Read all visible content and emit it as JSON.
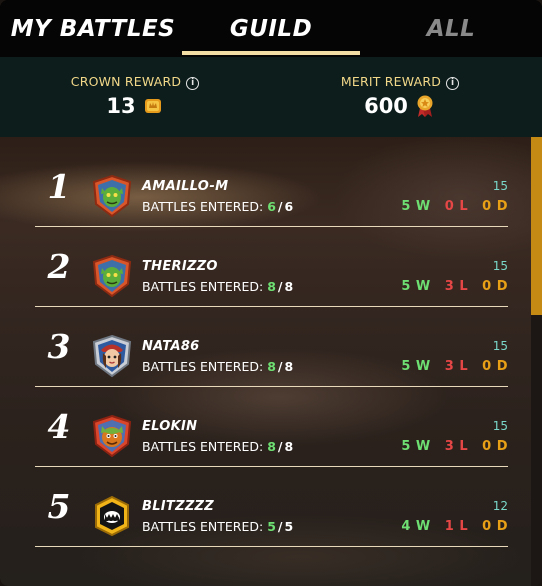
{
  "tabs": {
    "my_battles": "MY BATTLES",
    "guild": "GUILD",
    "all": "ALL",
    "active": "guild"
  },
  "rewards": {
    "crown": {
      "label": "CROWN REWARD",
      "value": "13",
      "icon": "crown-token-icon"
    },
    "merit": {
      "label": "MERIT REWARD",
      "value": "600",
      "icon": "merit-medal-icon"
    }
  },
  "battles_label": "BATTLES ENTERED:",
  "players": [
    {
      "rank": "1",
      "name": "AMAILLO-M",
      "entered": "6",
      "total": "6",
      "score": "15",
      "wins": "5 W",
      "losses": "0 L",
      "draws": "0 D",
      "avatar": "green-goblin-shield-avatar"
    },
    {
      "rank": "2",
      "name": "THERIZZO",
      "entered": "8",
      "total": "8",
      "score": "15",
      "wins": "5 W",
      "losses": "3 L",
      "draws": "0 D",
      "avatar": "green-goblin-shield-avatar"
    },
    {
      "rank": "3",
      "name": "NATA86",
      "entered": "8",
      "total": "8",
      "score": "15",
      "wins": "5 W",
      "losses": "3 L",
      "draws": "0 D",
      "avatar": "pirate-girl-shield-avatar"
    },
    {
      "rank": "4",
      "name": "ELOKIN",
      "entered": "8",
      "total": "8",
      "score": "15",
      "wins": "5 W",
      "losses": "3 L",
      "draws": "0 D",
      "avatar": "orange-goblin-shield-avatar"
    },
    {
      "rank": "5",
      "name": "BLITZZZZ",
      "entered": "5",
      "total": "5",
      "score": "12",
      "wins": "4 W",
      "losses": "1 L",
      "draws": "0 D",
      "avatar": "black-monster-badge-avatar"
    }
  ],
  "colors": {
    "tab_underline": "#f3dfa6",
    "reward_label": "#f2d889",
    "wins": "#6edf72",
    "losses": "#e54646",
    "draws": "#e8a017",
    "score": "#79d6c8",
    "scrollbar": "#c48a14"
  }
}
